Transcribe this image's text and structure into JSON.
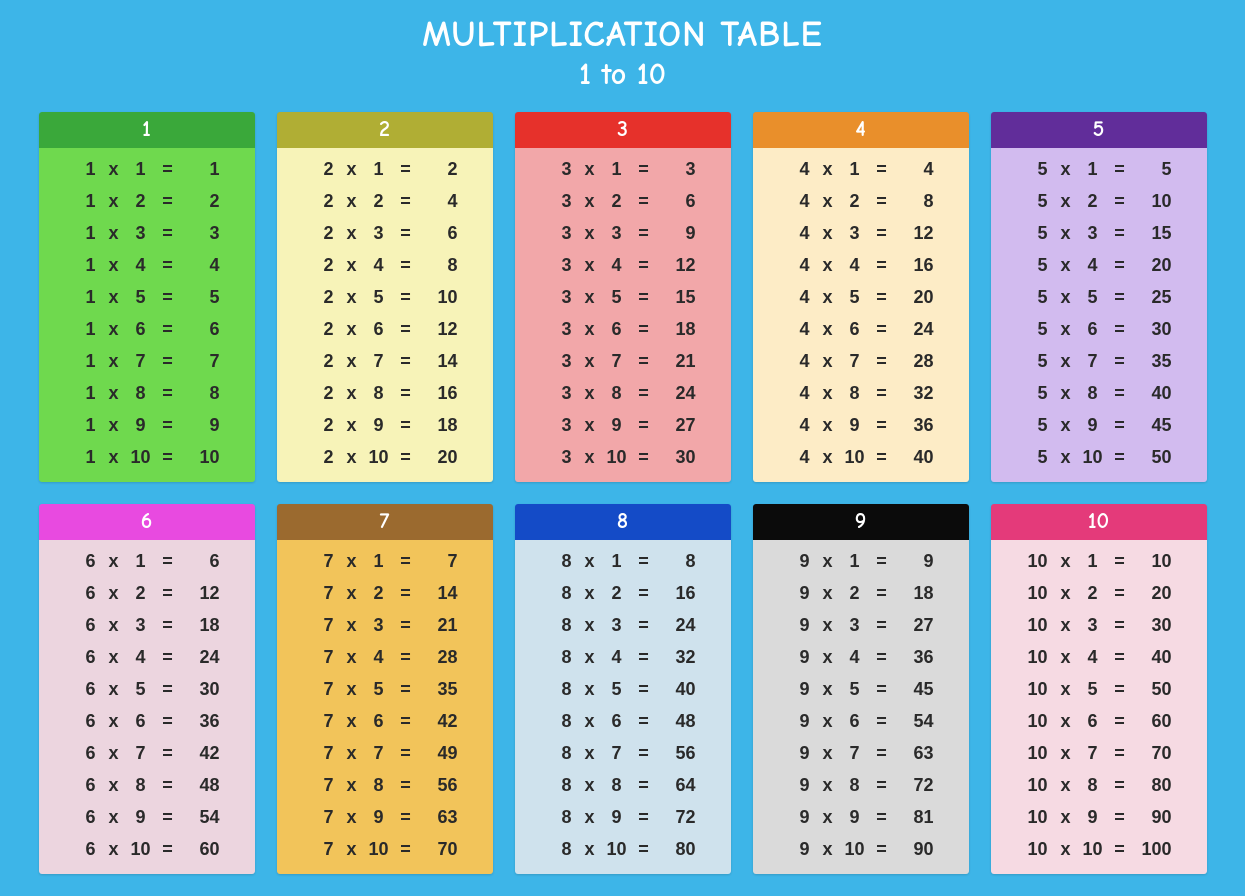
{
  "title": "MULTIPLICATION TABLE",
  "subtitle": "1 to 10",
  "cards": [
    {
      "label": "1",
      "header_bg": "#3aa83a",
      "body_bg": "#6fd94e",
      "a": 1
    },
    {
      "label": "2",
      "header_bg": "#b0ae34",
      "body_bg": "#f7f3b8",
      "a": 2
    },
    {
      "label": "3",
      "header_bg": "#e6312b",
      "body_bg": "#f2a7a9",
      "a": 3
    },
    {
      "label": "4",
      "header_bg": "#e98f2b",
      "body_bg": "#fdecc6",
      "a": 4
    },
    {
      "label": "5",
      "header_bg": "#612d9a",
      "body_bg": "#d2bbef",
      "a": 5
    },
    {
      "label": "6",
      "header_bg": "#e84ae0",
      "body_bg": "#ecd5df",
      "a": 6
    },
    {
      "label": "7",
      "header_bg": "#9b6a2f",
      "body_bg": "#f2c45a",
      "a": 7
    },
    {
      "label": "8",
      "header_bg": "#144bc7",
      "body_bg": "#cfe2ed",
      "a": 8
    },
    {
      "label": "9",
      "header_bg": "#0b0b0b",
      "body_bg": "#dadada",
      "a": 9
    },
    {
      "label": "10",
      "header_bg": "#e43a7a",
      "body_bg": "#f6dae3",
      "a": 10
    }
  ],
  "multipliers": [
    1,
    2,
    3,
    4,
    5,
    6,
    7,
    8,
    9,
    10
  ],
  "op": "x",
  "eq": "=",
  "chart_data": {
    "type": "table",
    "title": "MULTIPLICATION TABLE 1 to 10",
    "series": [
      {
        "name": "1",
        "x": [
          1,
          2,
          3,
          4,
          5,
          6,
          7,
          8,
          9,
          10
        ],
        "values": [
          1,
          2,
          3,
          4,
          5,
          6,
          7,
          8,
          9,
          10
        ]
      },
      {
        "name": "2",
        "x": [
          1,
          2,
          3,
          4,
          5,
          6,
          7,
          8,
          9,
          10
        ],
        "values": [
          2,
          4,
          6,
          8,
          10,
          12,
          14,
          16,
          18,
          20
        ]
      },
      {
        "name": "3",
        "x": [
          1,
          2,
          3,
          4,
          5,
          6,
          7,
          8,
          9,
          10
        ],
        "values": [
          3,
          6,
          9,
          12,
          15,
          18,
          21,
          24,
          27,
          30
        ]
      },
      {
        "name": "4",
        "x": [
          1,
          2,
          3,
          4,
          5,
          6,
          7,
          8,
          9,
          10
        ],
        "values": [
          4,
          8,
          12,
          16,
          20,
          24,
          28,
          32,
          36,
          40
        ]
      },
      {
        "name": "5",
        "x": [
          1,
          2,
          3,
          4,
          5,
          6,
          7,
          8,
          9,
          10
        ],
        "values": [
          5,
          10,
          15,
          20,
          25,
          30,
          35,
          40,
          45,
          50
        ]
      },
      {
        "name": "6",
        "x": [
          1,
          2,
          3,
          4,
          5,
          6,
          7,
          8,
          9,
          10
        ],
        "values": [
          6,
          12,
          18,
          24,
          30,
          36,
          42,
          48,
          54,
          60
        ]
      },
      {
        "name": "7",
        "x": [
          1,
          2,
          3,
          4,
          5,
          6,
          7,
          8,
          9,
          10
        ],
        "values": [
          7,
          14,
          21,
          28,
          35,
          42,
          49,
          56,
          63,
          70
        ]
      },
      {
        "name": "8",
        "x": [
          1,
          2,
          3,
          4,
          5,
          6,
          7,
          8,
          9,
          10
        ],
        "values": [
          8,
          16,
          24,
          32,
          40,
          48,
          56,
          64,
          72,
          80
        ]
      },
      {
        "name": "9",
        "x": [
          1,
          2,
          3,
          4,
          5,
          6,
          7,
          8,
          9,
          10
        ],
        "values": [
          9,
          18,
          27,
          36,
          45,
          54,
          63,
          72,
          81,
          90
        ]
      },
      {
        "name": "10",
        "x": [
          1,
          2,
          3,
          4,
          5,
          6,
          7,
          8,
          9,
          10
        ],
        "values": [
          10,
          20,
          30,
          40,
          50,
          60,
          70,
          80,
          90,
          100
        ]
      }
    ]
  }
}
